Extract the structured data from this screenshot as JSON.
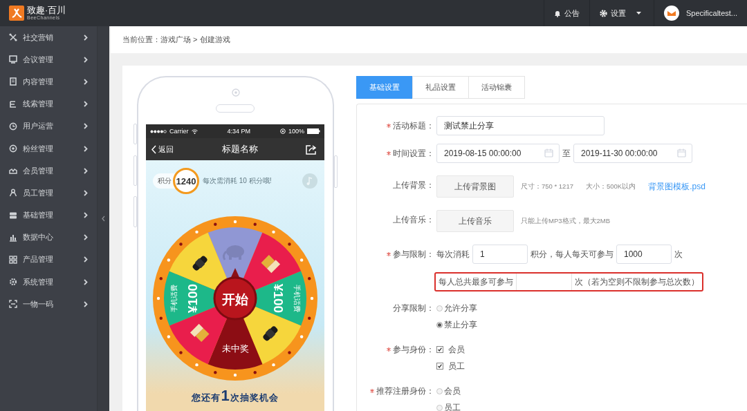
{
  "top_bar": {
    "logo": {
      "name": "致趣·百川",
      "tagline": "BeeChannels"
    },
    "notice": "公告",
    "settings": "设置",
    "user": "Specificaltest..."
  },
  "sidebar": {
    "items": [
      {
        "label": "社交营销"
      },
      {
        "label": "会议管理"
      },
      {
        "label": "内容管理"
      },
      {
        "label": "线索管理"
      },
      {
        "label": "用户运营"
      },
      {
        "label": "粉丝管理"
      },
      {
        "label": "会员管理"
      },
      {
        "label": "员工管理"
      },
      {
        "label": "基础管理"
      },
      {
        "label": "数据中心"
      },
      {
        "label": "产品管理"
      },
      {
        "label": "系统管理"
      },
      {
        "label": "一物一码"
      }
    ]
  },
  "breadcrumb": "当前位置：游戏广场 > 创建游戏",
  "preview": {
    "status_bar": {
      "carrier": "Carrier",
      "time": "4:34 PM",
      "battery": "100%"
    },
    "nav": {
      "back": "返回",
      "title": "标题名称"
    },
    "points_label": "积分",
    "points": "1240",
    "cost_hint": "每次需消耗 10 积分哦!",
    "wheel": {
      "start": "开始",
      "segments": [
        {
          "kind": "logo",
          "color": "#9097d4"
        },
        {
          "kind": "product",
          "color": "#e91e4c"
        },
        {
          "kind": "cash",
          "color": "#1db889",
          "label": "手机话费",
          "amount": "¥100"
        },
        {
          "kind": "watch",
          "color": "#f6d63c"
        },
        {
          "kind": "miss",
          "color": "#8c0d14",
          "label": "未中奖"
        },
        {
          "kind": "product",
          "color": "#e91e4c"
        },
        {
          "kind": "cash",
          "color": "#1db889",
          "label": "手机话费",
          "amount": "¥100"
        },
        {
          "kind": "watch",
          "color": "#f6d63c"
        }
      ]
    },
    "chances": "您还有**1**次抽奖机会"
  },
  "tabs": [
    {
      "label": "基础设置",
      "selected": true
    },
    {
      "label": "礼品设置",
      "selected": false
    },
    {
      "label": "活动锦囊",
      "selected": false
    }
  ],
  "form": {
    "rows": [
      {
        "kind": "text",
        "label": "活动标题：",
        "required": true,
        "value": "测试禁止分享"
      },
      {
        "kind": "daterange",
        "label": "时间设置：",
        "required": true,
        "start": "2019-08-15 00:00:00",
        "separator": "至",
        "end": "2019-11-30 00:00:00"
      },
      {
        "kind": "upload",
        "label": "上传背景：",
        "required": false,
        "button": "上传背景图",
        "hints": [
          "尺寸：750 * 1217",
          "大小：500K以内"
        ],
        "link": "背景图模板.psd"
      },
      {
        "kind": "upload",
        "label": "上传音乐：",
        "required": false,
        "button": "上传音乐",
        "hints": [
          "只能上传MP3格式，最大2MB"
        ]
      },
      {
        "kind": "limit",
        "label": "参与限制：",
        "required": true,
        "parts": [
          {
            "kind": "text",
            "text": "每次消耗"
          },
          {
            "kind": "input",
            "value": "1"
          },
          {
            "kind": "text",
            "text": "积分，每人每天可参与"
          },
          {
            "kind": "input",
            "value": "1000"
          },
          {
            "kind": "text",
            "text": "次"
          }
        ],
        "extra": {
          "highlighted": true,
          "parts": [
            {
              "kind": "text",
              "text": "每人总共最多可参与"
            },
            {
              "kind": "input"
            },
            {
              "kind": "text",
              "text": "次（若为空则不限制参与总次数）"
            }
          ]
        }
      },
      {
        "kind": "radio",
        "label": "分享限制：",
        "required": false,
        "options": [
          {
            "label": "允许分享",
            "selected": false
          },
          {
            "label": "禁止分享",
            "selected": true
          }
        ]
      },
      {
        "kind": "checkbox",
        "label": "参与身份：",
        "required": true,
        "options": [
          {
            "label": "会员",
            "checked": true
          },
          {
            "label": "员工",
            "checked": true
          }
        ]
      },
      {
        "kind": "radio",
        "label": "推荐注册身份：",
        "required": true,
        "options": [
          {
            "label": "会员",
            "selected": false
          },
          {
            "label": "员工",
            "selected": false
          }
        ]
      }
    ]
  }
}
